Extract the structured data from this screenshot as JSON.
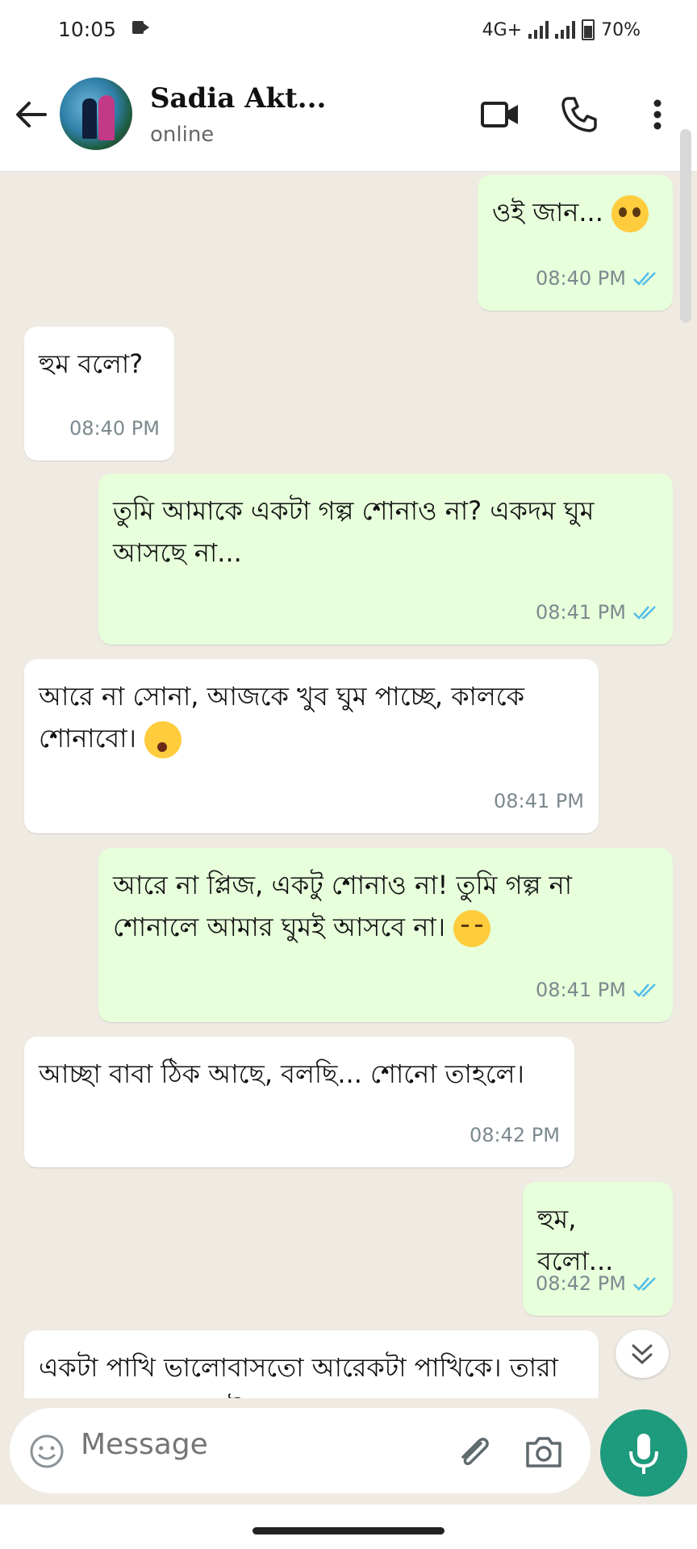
{
  "status_bar": {
    "time": "10:05",
    "network": "4G+",
    "battery": "70%"
  },
  "header": {
    "contact_name": "Sadia Akt...",
    "status": "online"
  },
  "messages": [
    {
      "dir": "out",
      "text": "ওই জান... ",
      "emoji": "pleading-face-icon",
      "time": "08:40 PM",
      "read": true
    },
    {
      "dir": "in",
      "text": "হুম বলো?",
      "time": "08:40 PM"
    },
    {
      "dir": "out",
      "text": "তুমি আমাকে একটা গল্প শোনাও না? একদম ঘুম আসছে না...",
      "time": "08:41 PM",
      "read": true
    },
    {
      "dir": "in",
      "text": "আরে না সোনা, আজকে খুব ঘুম পাচ্ছে, কালকে শোনাবো। ",
      "emoji": "yawning-face-icon",
      "time": "08:41 PM"
    },
    {
      "dir": "out",
      "text": "আরে না প্লিজ, একটু শোনাও না! তুমি গল্প না শোনালে আমার ঘুমই আসবে না। ",
      "emoji": "pensive-face-icon",
      "time": "08:41 PM",
      "read": true
    },
    {
      "dir": "in",
      "text": "আচ্ছা বাবা ঠিক আছে, বলছি... শোনো তাহলে।",
      "time": "08:42 PM"
    },
    {
      "dir": "out",
      "text": "হুম, বলো...",
      "time": "08:42 PM",
      "read": true
    },
    {
      "dir": "in",
      "text": "একটা পাখি ভালোবাসতো আরেকটা পাখিকে। তারা একসাথে আকাশে উড়ে বেড়াতো।",
      "time": ""
    }
  ],
  "composer": {
    "placeholder": "Message"
  },
  "colors": {
    "accent": "#1d9b7c",
    "outgoing_bubble": "#e7ffdb",
    "incoming_bubble": "#ffffff",
    "read_tick": "#53bdeb",
    "chat_bg": "#efeae2"
  }
}
